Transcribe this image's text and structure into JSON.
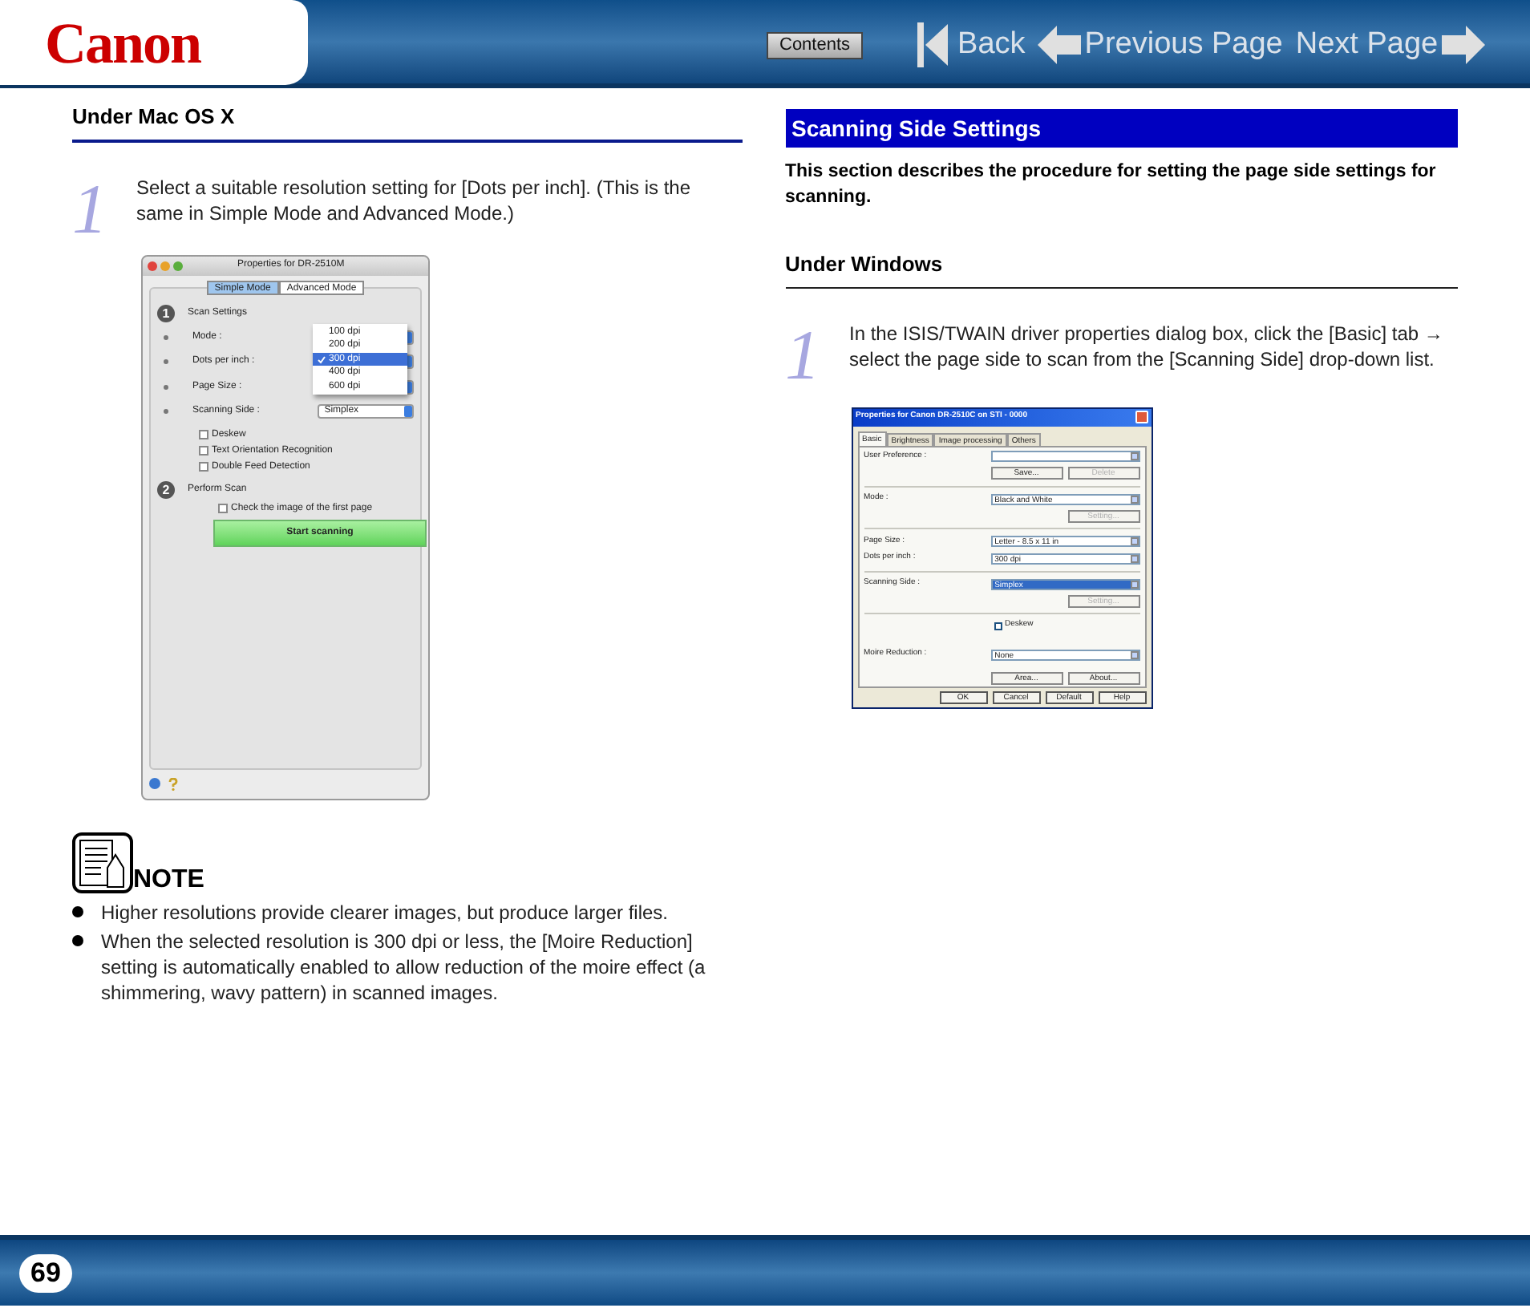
{
  "header": {
    "logo": "Canon",
    "nav": {
      "contents": "Contents",
      "back": "Back",
      "previous": "Previous Page",
      "next": "Next Page"
    }
  },
  "left": {
    "heading": "Under Mac OS X",
    "step": {
      "number": "1",
      "text": "Select a suitable resolution setting for [Dots per inch]. (This is the same in Simple Mode and Advanced Mode.)"
    },
    "mac_dialog": {
      "title": "Properties for DR-2510M",
      "tabs": [
        {
          "label": "Simple Mode",
          "selected": true
        },
        {
          "label": "Advanced Mode",
          "selected": false
        }
      ],
      "scan_settings": {
        "number": "1",
        "title": "Scan Settings",
        "rows": [
          {
            "label": "Mode :"
          },
          {
            "label": "Dots per inch :"
          },
          {
            "label": "Page Size :"
          },
          {
            "label": "Scanning Side :",
            "value": "Simplex"
          }
        ],
        "checkboxes": [
          {
            "label": "Deskew",
            "checked": false
          },
          {
            "label": "Text Orientation Recognition",
            "checked": false
          },
          {
            "label": "Double Feed Detection",
            "checked": false
          }
        ]
      },
      "dropdown": [
        {
          "label": "100 dpi",
          "selected": false
        },
        {
          "label": "200 dpi",
          "selected": false
        },
        {
          "label": "300 dpi",
          "selected": true
        },
        {
          "label": "400 dpi",
          "selected": false
        },
        {
          "label": "600 dpi",
          "selected": false
        }
      ],
      "perform_scan": {
        "number": "2",
        "title": "Perform Scan",
        "checkbox": {
          "label": "Check the image of the first page",
          "checked": false
        },
        "button": "Start scanning"
      }
    },
    "note": {
      "title": "NOTE",
      "items": [
        "Higher resolutions provide clearer images, but produce larger files.",
        "When the selected resolution is 300 dpi or less, the [Moire Reduction] setting is automatically enabled to allow reduction of the moire effect  (a shimmering, wavy pattern) in scanned images."
      ]
    }
  },
  "right": {
    "section_title": "Scanning Side Settings",
    "intro": "This section describes the procedure for setting the page side settings for scanning.",
    "subheading": "Under Windows",
    "step": {
      "number": "1",
      "text": "In the ISIS/TWAIN driver properties dialog box, click the [Basic] tab → select the page side to scan from the [Scanning Side] drop-down list."
    },
    "win_dialog": {
      "title": "Properties for Canon DR-2510C on STI - 0000",
      "tabs": [
        {
          "label": "Basic",
          "selected": true
        },
        {
          "label": "Brightness",
          "selected": false
        },
        {
          "label": "Image processing",
          "selected": false
        },
        {
          "label": "Others",
          "selected": false
        }
      ],
      "rows": [
        {
          "kind": "select",
          "label": "User Preference :",
          "value": "",
          "selected": false
        },
        {
          "kind": "buttons",
          "buttons": [
            {
              "label": "Save...",
              "disabled": false
            },
            {
              "label": "Delete",
              "disabled": true
            }
          ]
        },
        {
          "kind": "divider"
        },
        {
          "kind": "select",
          "label": "Mode :",
          "value": "Black and White",
          "selected": false
        },
        {
          "kind": "buttons",
          "buttons": [
            {
              "label": "Setting...",
              "disabled": true
            }
          ]
        },
        {
          "kind": "divider"
        },
        {
          "kind": "select",
          "label": "Page Size :",
          "value": "Letter - 8.5 x 11 in",
          "selected": false
        },
        {
          "kind": "select",
          "label": "Dots per inch :",
          "value": "300 dpi",
          "selected": false
        },
        {
          "kind": "divider"
        },
        {
          "kind": "select",
          "label": "Scanning Side :",
          "value": "Simplex",
          "selected": true
        },
        {
          "kind": "buttons",
          "buttons": [
            {
              "label": "Setting...",
              "disabled": true
            }
          ]
        },
        {
          "kind": "divider"
        },
        {
          "kind": "checkbox",
          "label": "Deskew",
          "checked": false
        },
        {
          "kind": "select",
          "label": "Moire Reduction :",
          "value": "None",
          "selected": false
        },
        {
          "kind": "spacer"
        },
        {
          "kind": "buttons",
          "buttons": [
            {
              "label": "Area...",
              "disabled": false
            },
            {
              "label": "About...",
              "disabled": false
            }
          ]
        }
      ],
      "footer_buttons": [
        "OK",
        "Cancel",
        "Default",
        "Help"
      ]
    }
  },
  "footer": {
    "page_number": "69"
  }
}
